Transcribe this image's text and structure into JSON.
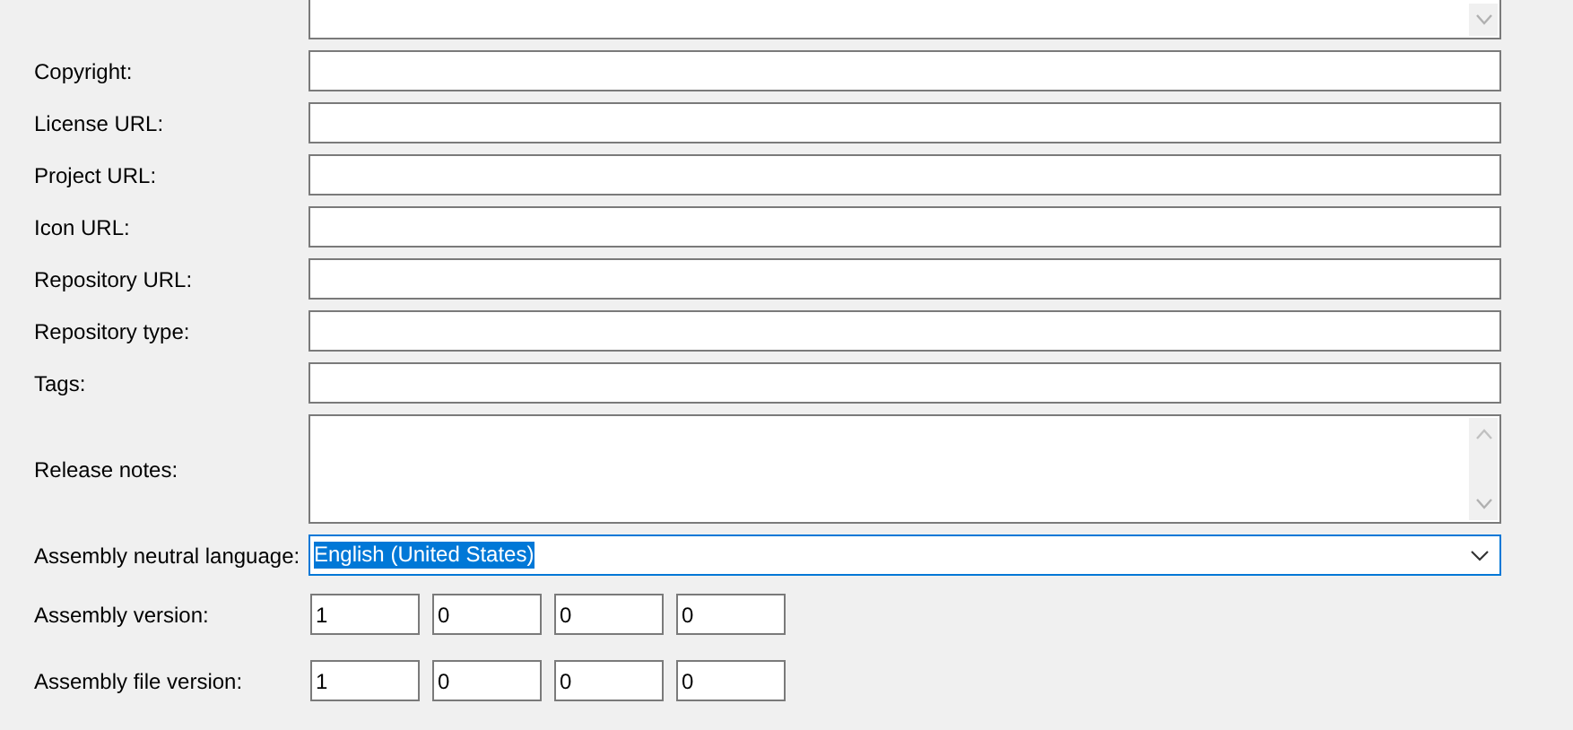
{
  "fields": [
    {
      "kind": "textarea_cut"
    },
    {
      "kind": "text",
      "label": "Copyright:"
    },
    {
      "kind": "text",
      "label": "License URL:"
    },
    {
      "kind": "text",
      "label": "Project URL:"
    },
    {
      "kind": "text",
      "label": "Icon URL:"
    },
    {
      "kind": "text",
      "label": "Repository URL:"
    },
    {
      "kind": "text",
      "label": "Repository type:"
    },
    {
      "kind": "text",
      "label": "Tags:"
    },
    {
      "kind": "textarea",
      "label": "Release notes:"
    },
    {
      "kind": "dropdown",
      "label": "Assembly neutral language:",
      "value": "English (United States)",
      "focused": true
    },
    {
      "kind": "version",
      "label": "Assembly version:",
      "parts": [
        "1",
        "0",
        "0",
        "0"
      ]
    },
    {
      "kind": "version",
      "label": "Assembly file version:",
      "parts": [
        "1",
        "0",
        "0",
        "0"
      ]
    }
  ]
}
